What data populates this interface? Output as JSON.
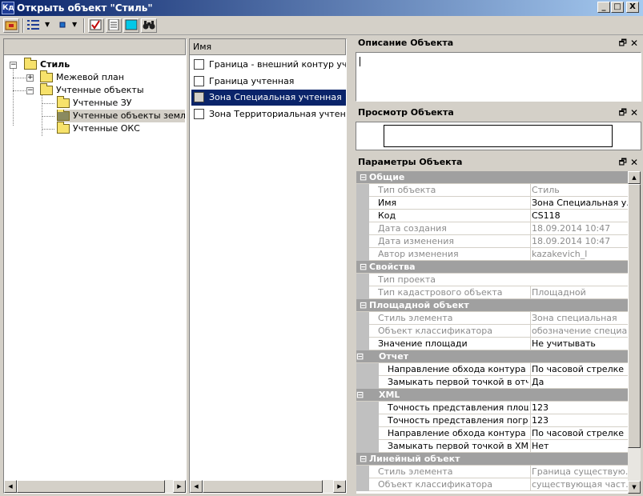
{
  "window": {
    "title": "Открыть объект \"Стиль\"",
    "app_icon_text": "Кд",
    "buttons": {
      "minimize": "_",
      "maximize": "□",
      "close": "X"
    }
  },
  "toolbar": {
    "icons": [
      "open-folder-icon",
      "view-options-icon",
      "small-icons-icon",
      "checkmark-icon",
      "document-icon",
      "preview-icon",
      "binoculars-icon"
    ]
  },
  "tree": {
    "items": [
      {
        "label": "Стиль",
        "bold": true
      },
      {
        "label": "Межевой план"
      },
      {
        "label": "Учтенные объекты"
      },
      {
        "label": "Учтенные ЗУ"
      },
      {
        "label": "Учтенные объекты землеу",
        "selected": true
      },
      {
        "label": "Учтенные ОКС"
      }
    ]
  },
  "list": {
    "column_header": "Имя",
    "items": [
      {
        "label": "Граница - внешний контур учтенн"
      },
      {
        "label": "Граница учтенная"
      },
      {
        "label": "Зона Специальная учтенная",
        "selected": true
      },
      {
        "label": "Зона Территориальная учтенная"
      }
    ]
  },
  "panels": {
    "description": {
      "title": "Описание Объекта",
      "pin": "🗗",
      "close": "✕"
    },
    "preview": {
      "title": "Просмотр Объекта",
      "pin": "🗗",
      "close": "✕"
    },
    "params": {
      "title": "Параметры Объекта",
      "pin": "🗗",
      "close": "✕"
    }
  },
  "properties": [
    {
      "kind": "cat",
      "name": "Общие"
    },
    {
      "kind": "prop",
      "name": "Тип объекта",
      "value": "Стиль",
      "readonly": true
    },
    {
      "kind": "prop",
      "name": "Имя",
      "value": "Зона Специальная у..."
    },
    {
      "kind": "prop",
      "name": "Код",
      "value": "CS118"
    },
    {
      "kind": "prop",
      "name": "Дата создания",
      "value": "18.09.2014 10:47",
      "readonly": true
    },
    {
      "kind": "prop",
      "name": "Дата изменения",
      "value": "18.09.2014 10:47",
      "readonly": true
    },
    {
      "kind": "prop",
      "name": "Автор изменения",
      "value": "kazakevich_l",
      "readonly": true
    },
    {
      "kind": "cat",
      "name": "Свойства"
    },
    {
      "kind": "prop",
      "name": "Тип проекта",
      "value": "",
      "readonly": true
    },
    {
      "kind": "prop",
      "name": "Тип кадастрового объекта",
      "value": "Площадной",
      "readonly": true
    },
    {
      "kind": "cat",
      "name": "Площадной объект"
    },
    {
      "kind": "prop",
      "name": "Стиль элемента",
      "value": "Зона специальная",
      "readonly": true
    },
    {
      "kind": "prop",
      "name": "Объект классификатора",
      "value": "обозначение специа...",
      "readonly": true
    },
    {
      "kind": "prop",
      "name": "Значение площади",
      "value": "Не учитывать"
    },
    {
      "kind": "sub",
      "name": "Отчет"
    },
    {
      "kind": "subprop",
      "name": "Направление обхода контура",
      "value": "По часовой стрелке"
    },
    {
      "kind": "subprop",
      "name": "Замыкать первой точкой в отч...",
      "value": "Да"
    },
    {
      "kind": "sub",
      "name": "XML"
    },
    {
      "kind": "subprop",
      "name": "Точность представления площ...",
      "value": "123"
    },
    {
      "kind": "subprop",
      "name": "Точность представления погре...",
      "value": "123"
    },
    {
      "kind": "subprop",
      "name": "Направление обхода контура",
      "value": "По часовой стрелке"
    },
    {
      "kind": "subprop",
      "name": "Замыкать первой точкой в XML",
      "value": "Нет"
    },
    {
      "kind": "cat",
      "name": "Линейный объект"
    },
    {
      "kind": "prop",
      "name": "Стиль элемента",
      "value": "Граница существую...",
      "readonly": true
    },
    {
      "kind": "prop",
      "name": "Объект классификатора",
      "value": "существующая част...",
      "readonly": true
    }
  ]
}
